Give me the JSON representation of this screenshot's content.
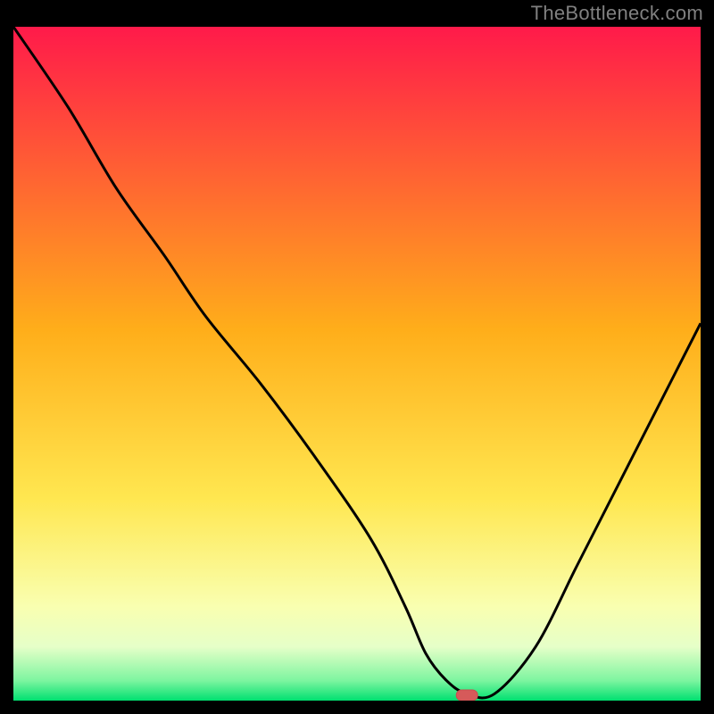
{
  "watermark": "TheBottleneck.com",
  "colors": {
    "page_bg": "#000000",
    "grad_top": "#ff1a4a",
    "grad_mid": "#ffd400",
    "grad_low": "#f7ff9c",
    "grad_bottom": "#00e070",
    "curve": "#000000",
    "marker_fill": "#d65a5a",
    "marker_stroke": "#c94e4e",
    "watermark": "#808080"
  },
  "chart_data": {
    "type": "line",
    "title": "",
    "xlabel": "",
    "ylabel": "",
    "xlim": [
      0,
      100
    ],
    "ylim": [
      0,
      100
    ],
    "x": [
      0,
      8,
      15,
      22,
      28,
      36,
      44,
      52,
      57,
      60,
      63,
      66,
      70,
      76,
      82,
      88,
      94,
      100
    ],
    "values": [
      100,
      88,
      76,
      66,
      57,
      47,
      36,
      24,
      14,
      7,
      3,
      1,
      1,
      8,
      20,
      32,
      44,
      56
    ],
    "marker": {
      "x": 66,
      "y": 0.8
    },
    "grid": false,
    "legend": false
  }
}
